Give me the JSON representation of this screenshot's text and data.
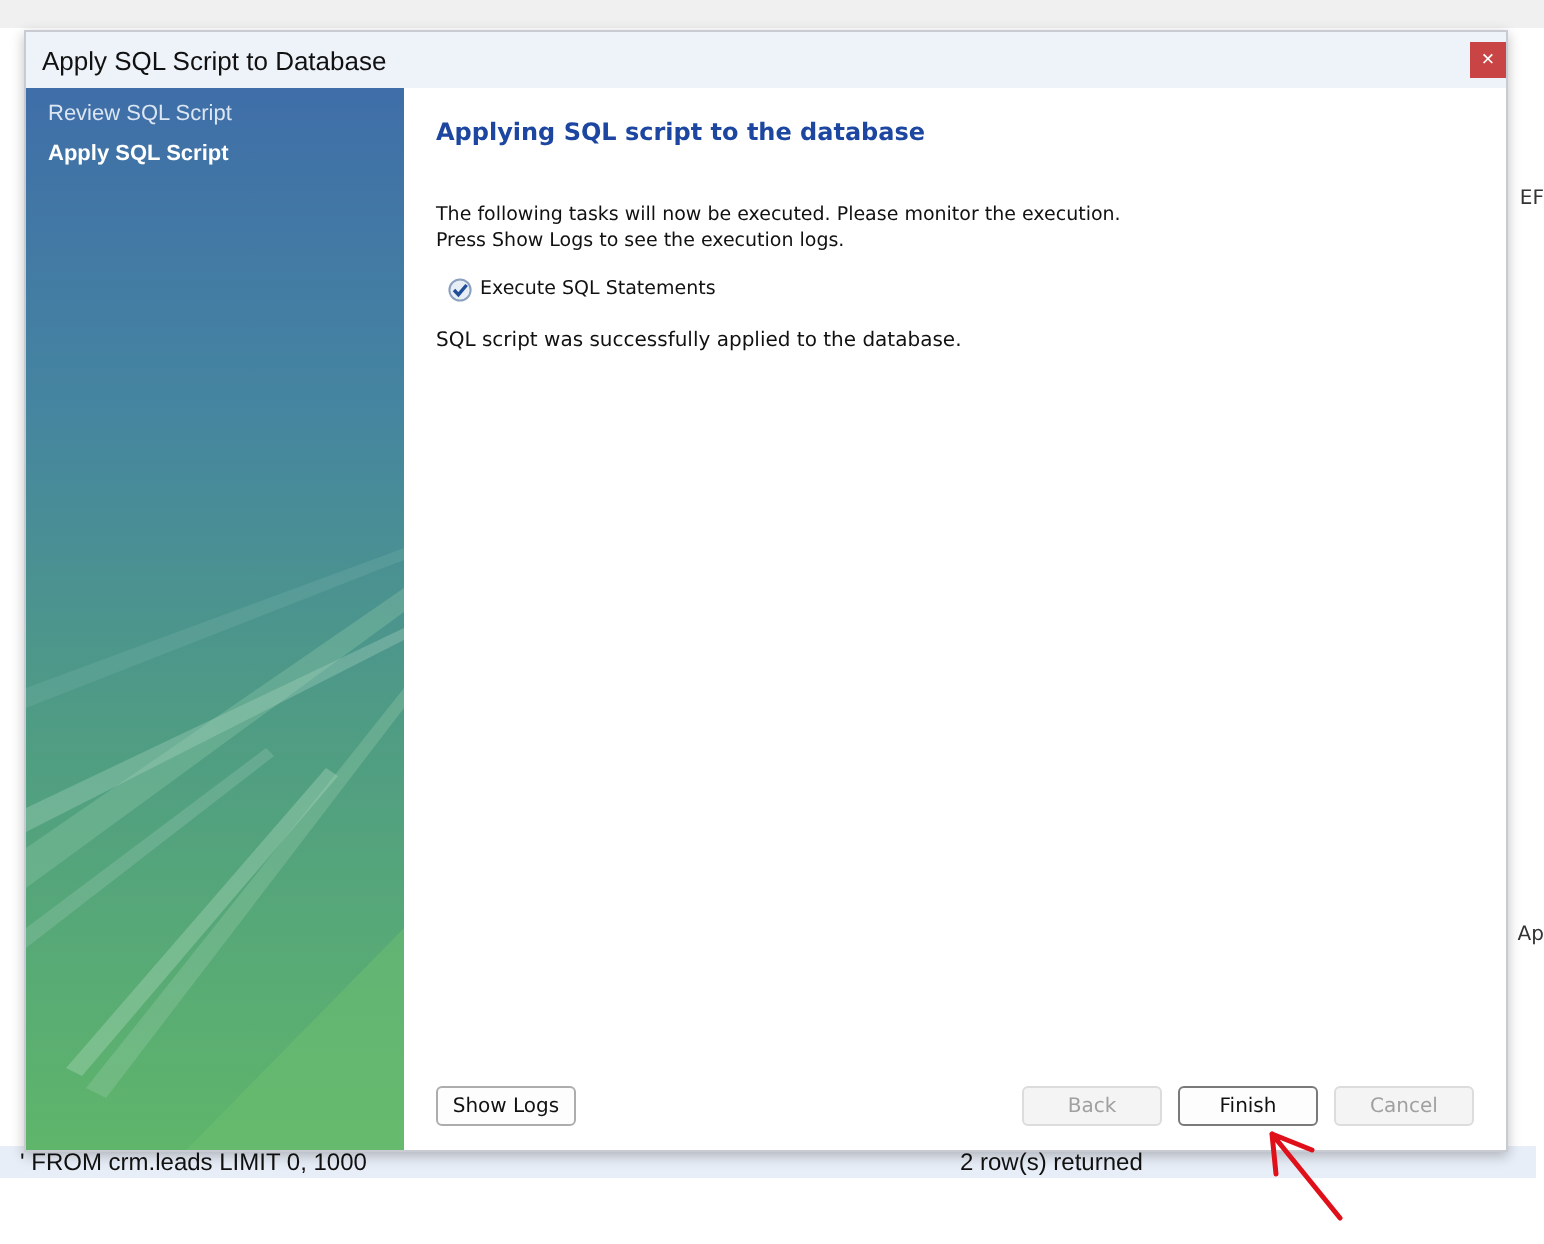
{
  "background": {
    "edge_texts": [
      "EF",
      "Ap"
    ],
    "status_bar": {
      "query": "' FROM crm.leads LIMIT 0, 1000",
      "result": "2 row(s) returned"
    }
  },
  "dialog": {
    "title": "Apply SQL Script to Database",
    "close": "×",
    "steps": [
      {
        "label": "Review SQL Script",
        "selected": false
      },
      {
        "label": "Apply SQL Script",
        "selected": true
      }
    ],
    "heading": "Applying SQL script to the database",
    "intro": [
      "The following tasks will now be executed. Please monitor the execution.",
      "Press Show Logs to see the execution logs."
    ],
    "tasks": [
      {
        "label": "Execute SQL Statements",
        "checked": true
      }
    ],
    "result": "SQL script was successfully applied to the database.",
    "left_buttons": [
      {
        "label": "Show Logs",
        "disabled": false,
        "focused": false
      }
    ],
    "right_buttons": [
      {
        "label": "Back",
        "disabled": true,
        "focused": false
      },
      {
        "label": "Finish",
        "disabled": false,
        "focused": true
      },
      {
        "label": "Cancel",
        "disabled": true,
        "focused": false
      }
    ]
  }
}
